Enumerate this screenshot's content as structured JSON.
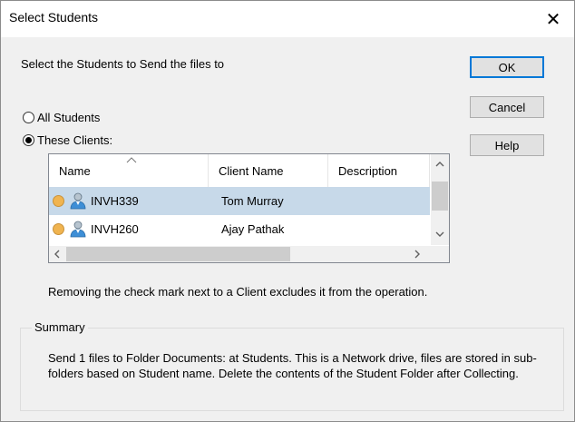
{
  "window": {
    "title": "Select Students",
    "close_glyph": "✕"
  },
  "prompt": "Select the Students to Send the files to",
  "buttons": {
    "ok": "OK",
    "cancel": "Cancel",
    "help": "Help"
  },
  "options": {
    "all_students": "All Students",
    "these_clients": "These Clients:",
    "selected": "these_clients"
  },
  "list": {
    "columns": [
      "Name",
      "Client Name",
      "Description"
    ],
    "sorted_column": "Name",
    "rows": [
      {
        "name": "INVH339",
        "client_name": "Tom Murray",
        "description": "",
        "selected": true,
        "status_color": "#f0b450",
        "icon": "user-icon"
      },
      {
        "name": "INVH260",
        "client_name": "Ajay Pathak",
        "description": "",
        "selected": false,
        "status_color": "#f0b450",
        "icon": "user-icon"
      }
    ],
    "scroll": {
      "up": "^",
      "down": "v",
      "left": "<",
      "right": ">"
    }
  },
  "note": "Removing the check mark next to a Client excludes it from the operation.",
  "summary": {
    "label": "Summary",
    "text": "Send 1 files to Folder Documents: at Students. This is a Network drive, files are stored in sub-folders based on Student name.  Delete the contents of the Student Folder after Collecting."
  },
  "colors": {
    "selection": "#c7d9e9",
    "default_button_border": "#0078d7",
    "status": "#f0b450"
  }
}
